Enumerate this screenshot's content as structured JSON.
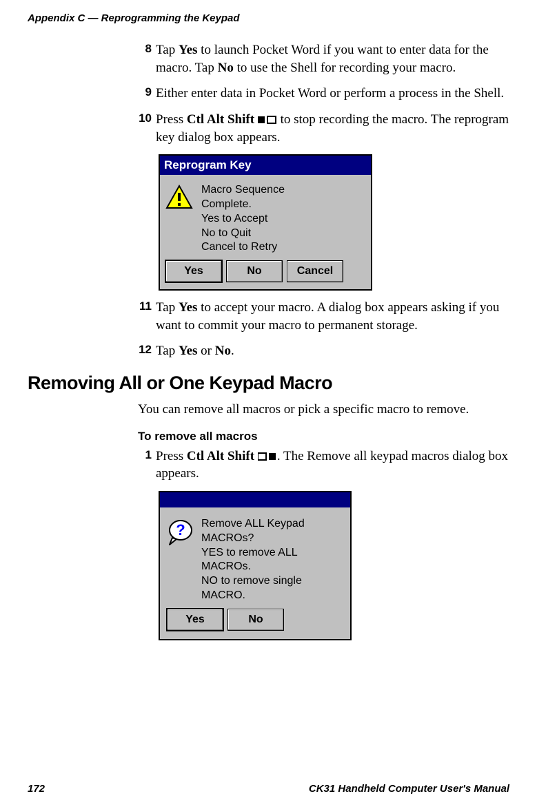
{
  "runningHead": "Appendix C — Reprogramming the Keypad",
  "steps": {
    "s8_num": "8",
    "s8a": "Tap ",
    "s8_yes": "Yes",
    "s8b": " to launch Pocket Word if you want to enter data for the macro. Tap ",
    "s8_no": "No",
    "s8c": " to use the Shell for recording your macro.",
    "s9_num": "9",
    "s9": "Either enter data in Pocket Word or perform a process in the Shell.",
    "s10_num": "10",
    "s10a": "Press ",
    "s10_key": "Ctl Alt Shift",
    "s10b": " to stop recording the macro. The reprogram key dialog box appears.",
    "s11_num": "11",
    "s11a": "Tap ",
    "s11_yes": "Yes",
    "s11b": " to accept your macro. A dialog box appears asking if you want to commit your macro to permanent storage.",
    "s12_num": "12",
    "s12a": "Tap ",
    "s12_yes": "Yes",
    "s12b": " or ",
    "s12_no": "No",
    "s12c": "."
  },
  "dialog1": {
    "title": "Reprogram Key",
    "line1": "Macro Sequence",
    "line2": "Complete.",
    "line3": "Yes to Accept",
    "line4": "No to Quit",
    "line5": "Cancel to Retry",
    "btnYes": "Yes",
    "btnNo": "No",
    "btnCancel": "Cancel"
  },
  "h2": "Removing All or One Keypad Macro",
  "intro": "You can remove all macros or pick a specific macro to remove.",
  "h3": "To remove all macros",
  "removeStep": {
    "num": "1",
    "a": "Press ",
    "key": "Ctl Alt Shift",
    "b": ". The Remove all keypad macros dialog box appears."
  },
  "dialog2": {
    "line1": "Remove ALL Keypad",
    "line2": "MACROs?",
    "line3": "YES to remove ALL",
    "line4": "MACROs.",
    "line5": "NO to remove single",
    "line6": "MACRO.",
    "btnYes": "Yes",
    "btnNo": "No"
  },
  "footer": {
    "pageNum": "172",
    "manual": "CK31 Handheld Computer User's Manual"
  }
}
